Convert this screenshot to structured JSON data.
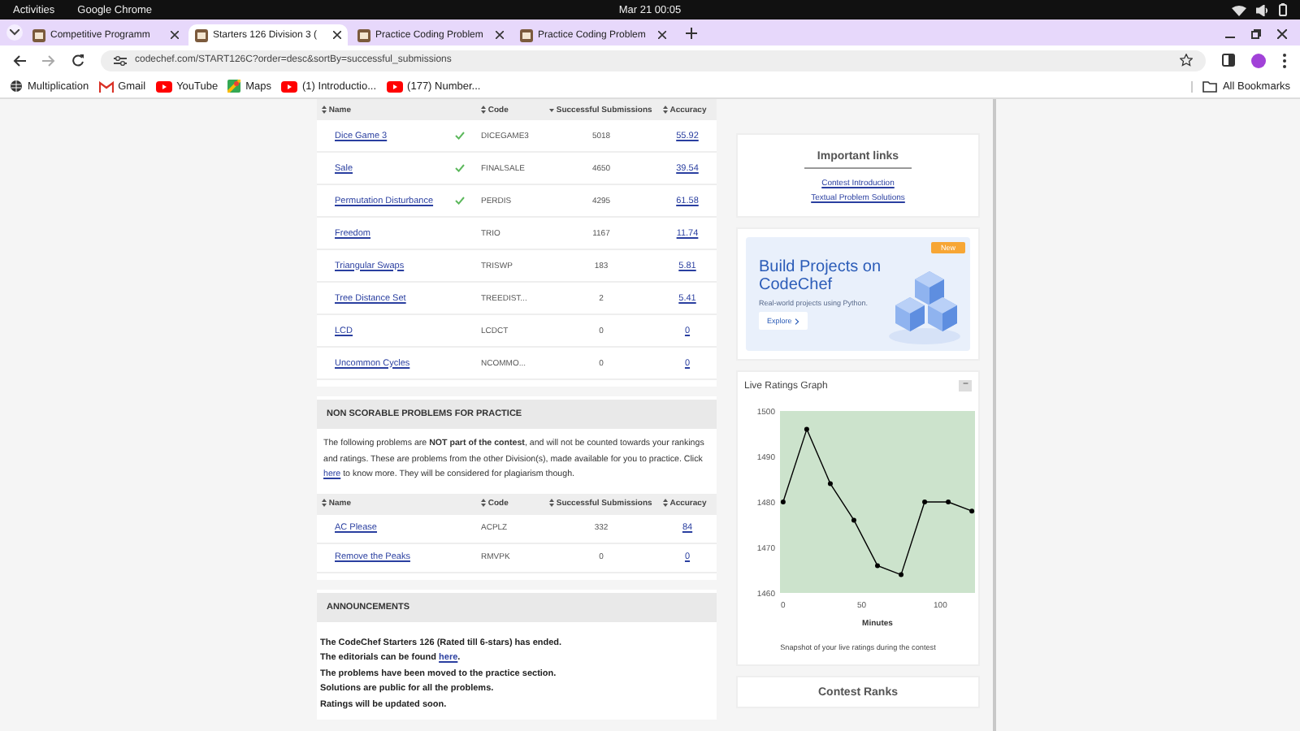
{
  "system_bar": {
    "activities": "Activities",
    "app": "Google Chrome",
    "clock": "Mar 21  00:05"
  },
  "tabs": [
    {
      "title": "Competitive Programm",
      "selected": false
    },
    {
      "title": "Starters 126 Division 3 (",
      "selected": true
    },
    {
      "title": "Practice Coding Problem",
      "selected": false
    },
    {
      "title": "Practice Coding Problem",
      "selected": false
    }
  ],
  "address_bar": {
    "url": "codechef.com/START126C?order=desc&sortBy=successful_submissions"
  },
  "bookmarks": [
    {
      "label": "Multiplication",
      "kind": "globe"
    },
    {
      "label": "Gmail",
      "kind": "gmail"
    },
    {
      "label": "YouTube",
      "kind": "youtube"
    },
    {
      "label": "Maps",
      "kind": "maps"
    },
    {
      "label": "(1) Introductio...",
      "kind": "youtube"
    },
    {
      "label": "(177) Number...",
      "kind": "youtube"
    }
  ],
  "all_bookmarks": "All Bookmarks",
  "problems_table": {
    "columns": [
      {
        "label": "Name",
        "sorted": false
      },
      {
        "label": "Code",
        "sorted": false
      },
      {
        "label": "Successful Submissions",
        "sorted": true
      },
      {
        "label": "Accuracy",
        "sorted": false
      }
    ],
    "rows": [
      {
        "name": "Dice Game 3",
        "solved": true,
        "code": "DICEGAME3",
        "submissions": "5018",
        "accuracy": "55.92"
      },
      {
        "name": "Sale",
        "solved": true,
        "code": "FINALSALE",
        "submissions": "4650",
        "accuracy": "39.54"
      },
      {
        "name": "Permutation Disturbance",
        "solved": true,
        "code": "PERDIS",
        "submissions": "4295",
        "accuracy": "61.58"
      },
      {
        "name": "Freedom",
        "solved": false,
        "code": "TRIO",
        "submissions": "1167",
        "accuracy": "11.74"
      },
      {
        "name": "Triangular Swaps",
        "solved": false,
        "code": "TRISWP",
        "submissions": "183",
        "accuracy": "5.81"
      },
      {
        "name": "Tree Distance Set",
        "solved": false,
        "code": "TREEDIST...",
        "submissions": "2",
        "accuracy": "5.41"
      },
      {
        "name": "LCD",
        "solved": false,
        "code": "LCDCT",
        "submissions": "0",
        "accuracy": "0"
      },
      {
        "name": "Uncommon Cycles",
        "solved": false,
        "code": "NCOMMO...",
        "submissions": "0",
        "accuracy": "0"
      }
    ]
  },
  "non_scorable": {
    "heading": "NON SCORABLE PROBLEMS FOR PRACTICE",
    "text": "The following problems are **NOT part of the contest**, and will not be counted towards your rankings and ratings. These are problems from the other Division(s), made available for you to practice. Click ",
    "link": "here",
    "text_after": " to know more. They will be considered for plagiarism though.",
    "columns": [
      {
        "label": "Name",
        "sorted": false
      },
      {
        "label": "Code",
        "sorted": false
      },
      {
        "label": "Successful Submissions",
        "sorted": false
      },
      {
        "label": "Accuracy",
        "sorted": false
      }
    ],
    "rows": [
      {
        "name": "AC Please",
        "solved": false,
        "code": "ACPLZ",
        "submissions": "332",
        "accuracy": "84"
      },
      {
        "name": "Remove the Peaks",
        "solved": false,
        "code": "RMVPK",
        "submissions": "0",
        "accuracy": "0"
      }
    ]
  },
  "announcements": {
    "heading": "ANNOUNCEMENTS",
    "lines": [
      {
        "text": "The CodeChef Starters 126 (Rated till 6-stars) has ended."
      },
      {
        "text": "The editorials can be found ",
        "link": "here",
        "after": "."
      },
      {
        "text": "The problems have been moved to the practice section."
      },
      {
        "text": "Solutions are public for all the problems."
      },
      {
        "text": "Ratings will be updated soon."
      }
    ]
  },
  "important_links": {
    "title": "Important links",
    "links": [
      "Contest Introduction",
      "Textual Problem Solutions"
    ]
  },
  "banner": {
    "badge": "New",
    "title": "Build Projects on CodeChef",
    "subtitle": "Real-world projects using Python.",
    "button": "Explore"
  },
  "ratings_graph": {
    "title": "Live Ratings Graph",
    "collapse": "−",
    "caption": "Snapshot of your live ratings during the contest",
    "chart_data": {
      "type": "line",
      "xlabel": "Minutes",
      "x": [
        0,
        15,
        30,
        45,
        60,
        75,
        90,
        105,
        120
      ],
      "series": [
        {
          "color": "#000000",
          "marker": "circle",
          "values": [
            1480,
            1496,
            1484,
            1476,
            1466,
            1464,
            1480,
            1480,
            1478
          ]
        }
      ],
      "xlim": [
        -2,
        122
      ],
      "ylim": [
        1460,
        1500
      ],
      "xticks": [
        0,
        50,
        100
      ],
      "yticks": [
        1460,
        1470,
        1480,
        1490,
        1500
      ]
    }
  },
  "contest_ranks": {
    "title": "Contest Ranks"
  }
}
